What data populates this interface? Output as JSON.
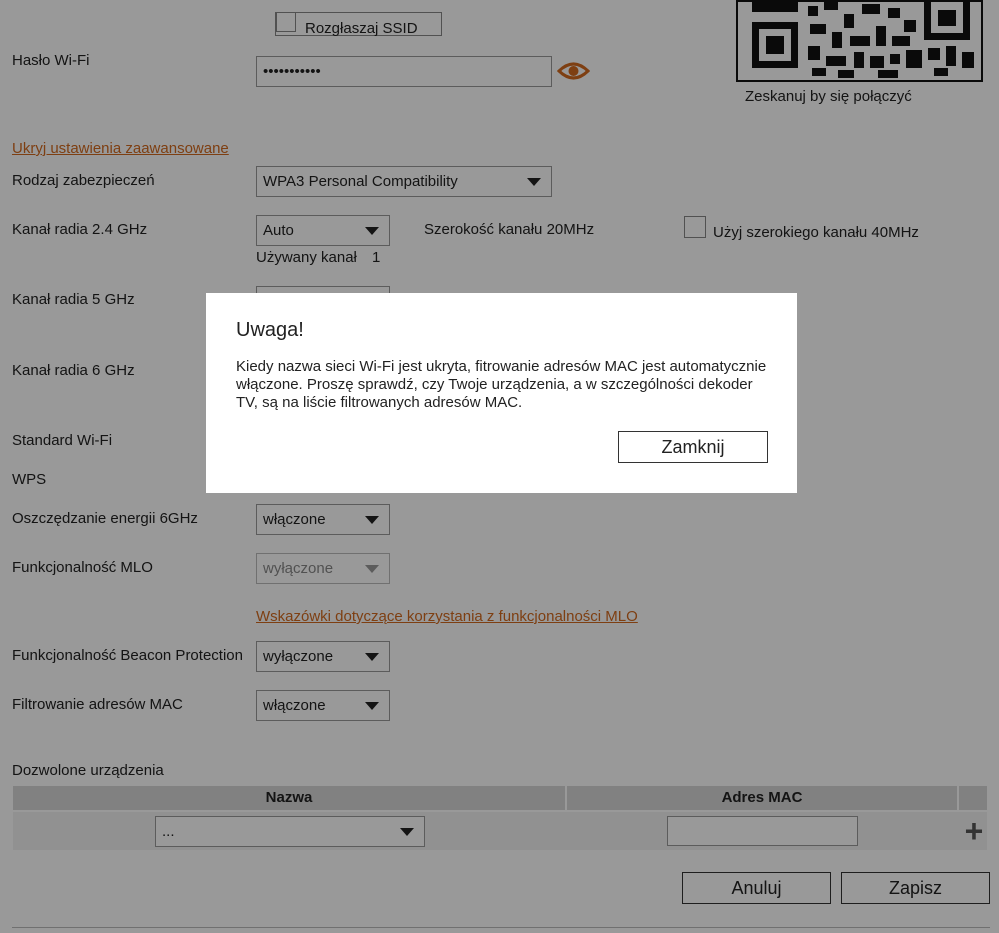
{
  "form": {
    "broadcast_ssid_label": "Rozgłaszaj SSID",
    "wifi_password_label": "Hasło Wi-Fi",
    "wifi_password_value": "•••••••••••",
    "qr_caption": "Zeskanuj by się połączyć",
    "hide_advanced_link": "Ukryj ustawienia zaawansowane",
    "security_type_label": "Rodzaj zabezpieczeń",
    "security_type_value": "WPA3 Personal Compatibility",
    "radio_24_label": "Kanał radia 2.4 GHz",
    "radio_24_value": "Auto",
    "channel_width_label": "Szerokość kanału 20MHz",
    "wide_channel_label": "Użyj szerokiego kanału 40MHz",
    "used_channel_label": "Używany kanał",
    "used_channel_value": "1",
    "radio_5_label": "Kanał radia 5 GHz",
    "radio_6_label": "Kanał radia 6 GHz",
    "wifi_standard_label": "Standard Wi-Fi",
    "wps_label": "WPS",
    "power_saving_label": "Oszczędzanie energii 6GHz",
    "power_saving_value": "włączone",
    "mlo_label": "Funkcjonalność MLO",
    "mlo_value": "wyłączone",
    "mlo_tips_link": "Wskazówki dotyczące korzystania z funkcjonalności MLO",
    "beacon_label": "Funkcjonalność Beacon Protection",
    "beacon_value": "wyłączone",
    "mac_filter_label": "Filtrowanie adresów MAC",
    "mac_filter_value": "włączone"
  },
  "allowed_devices": {
    "title": "Dozwolone urządzenia",
    "columns": [
      "Nazwa",
      "Adres MAC"
    ],
    "row": {
      "name_select": "...",
      "mac_value": ""
    },
    "add_symbol": "+"
  },
  "actions": {
    "cancel_label": "Anuluj",
    "save_label": "Zapisz"
  },
  "modal": {
    "title": "Uwaga!",
    "message": "Kiedy nazwa sieci Wi-Fi jest ukryta, fitrowanie adresów MAC jest automatycznie włączone. Proszę sprawdź, czy Twoje urządzenia, a w szczególności dekoder TV, są na liście filtrowanych adresów MAC.",
    "close_label": "Zamknij"
  },
  "colors": {
    "accent": "#d2691e",
    "overlay": "rgba(0,0,0,0.4)"
  },
  "icons": [
    "eye-icon",
    "qr-code",
    "caret-down-icon",
    "plus-icon"
  ]
}
